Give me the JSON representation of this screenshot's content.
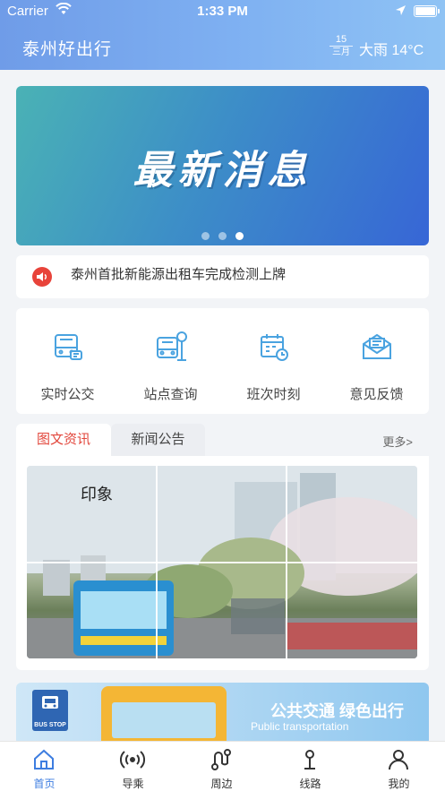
{
  "status_bar": {
    "carrier": "Carrier",
    "time": "1:33 PM"
  },
  "header": {
    "title": "泰州好出行",
    "date_day": "15",
    "date_month": "三月",
    "weather": "大雨 14°C"
  },
  "banner": {
    "headline": "最新消息",
    "page_count": 3,
    "active_page": 3
  },
  "notice": {
    "text": "泰州首批新能源出租车完成检测上牌"
  },
  "services": [
    {
      "label": "实时公交",
      "icon": "bus-icon"
    },
    {
      "label": "站点查询",
      "icon": "bus-stop-icon"
    },
    {
      "label": "班次时刻",
      "icon": "schedule-icon"
    },
    {
      "label": "意见反馈",
      "icon": "feedback-mail-icon"
    }
  ],
  "news": {
    "tabs": [
      "图文资讯",
      "新闻公告"
    ],
    "active_tab": "图文资讯",
    "more": "更多>"
  },
  "promo": {
    "slogan": "公共交通  绿色出行",
    "slogan_en": "Public transportation",
    "bus_stop_sign": "BUS STOP"
  },
  "tabbar": [
    {
      "label": "首页",
      "icon": "home-icon",
      "active": true
    },
    {
      "label": "导乘",
      "icon": "signal-icon",
      "active": false
    },
    {
      "label": "周边",
      "icon": "route-icon",
      "active": false
    },
    {
      "label": "线路",
      "icon": "line-icon",
      "active": false
    },
    {
      "label": "我的",
      "icon": "user-icon",
      "active": false
    }
  ],
  "colors": {
    "accent": "#3d7de0",
    "alert": "#e2463b",
    "icon_blue": "#4aa3e0"
  }
}
